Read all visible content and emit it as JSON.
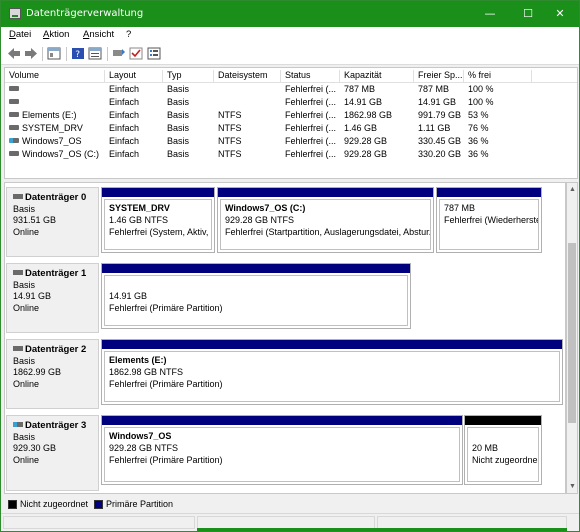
{
  "window": {
    "title": "Datenträgerverwaltung",
    "minimize": "—",
    "maximize": "☐",
    "close": "✕"
  },
  "menu": [
    "Datei",
    "Aktion",
    "Ansicht",
    "?"
  ],
  "toolbar": [
    "back-icon",
    "forward-icon",
    "console-tree-icon",
    "help-icon",
    "properties-icon",
    "rescan-icon",
    "check-icon",
    "list-icon"
  ],
  "volumes": {
    "headers": [
      "Volume",
      "Layout",
      "Typ",
      "Dateisystem",
      "Status",
      "Kapazität",
      "Freier Sp...",
      "% frei"
    ],
    "rows": [
      {
        "volume": "",
        "layout": "Einfach",
        "typ": "Basis",
        "fs": "",
        "status": "Fehlerfrei (...",
        "cap": "787 MB",
        "free": "787 MB",
        "pct": "100 %",
        "icon": "drive"
      },
      {
        "volume": "",
        "layout": "Einfach",
        "typ": "Basis",
        "fs": "",
        "status": "Fehlerfrei (...",
        "cap": "14.91 GB",
        "free": "14.91 GB",
        "pct": "100 %",
        "icon": "drive"
      },
      {
        "volume": "Elements (E:)",
        "layout": "Einfach",
        "typ": "Basis",
        "fs": "NTFS",
        "status": "Fehlerfrei (...",
        "cap": "1862.98 GB",
        "free": "991.79 GB",
        "pct": "53 %",
        "icon": "drive"
      },
      {
        "volume": "SYSTEM_DRV",
        "layout": "Einfach",
        "typ": "Basis",
        "fs": "NTFS",
        "status": "Fehlerfrei (...",
        "cap": "1.46 GB",
        "free": "1.11 GB",
        "pct": "76 %",
        "icon": "drive"
      },
      {
        "volume": "Windows7_OS",
        "layout": "Einfach",
        "typ": "Basis",
        "fs": "NTFS",
        "status": "Fehlerfrei (...",
        "cap": "929.28 GB",
        "free": "330.45 GB",
        "pct": "36 %",
        "icon": "os-drive"
      },
      {
        "volume": "Windows7_OS (C:)",
        "layout": "Einfach",
        "typ": "Basis",
        "fs": "NTFS",
        "status": "Fehlerfrei (...",
        "cap": "929.28 GB",
        "free": "330.20 GB",
        "pct": "36 %",
        "icon": "drive"
      }
    ]
  },
  "disks": [
    {
      "name": "Datenträger 0",
      "type": "Basis",
      "size": "931.51 GB",
      "state": "Online",
      "icon": "drive",
      "partitions": [
        {
          "name": "SYSTEM_DRV",
          "size": "1.46 GB NTFS",
          "status": "Fehlerfrei (System, Aktiv, I",
          "bar": "primary"
        },
        {
          "name": "Windows7_OS  (C:)",
          "size": "929.28 GB NTFS",
          "status": "Fehlerfrei (Startpartition, Auslagerungsdatei, Absturz",
          "bar": "primary"
        },
        {
          "name": "",
          "size": "787 MB",
          "status": "Fehlerfrei (Wiederherste",
          "bar": "primary"
        }
      ]
    },
    {
      "name": "Datenträger 1",
      "type": "Basis",
      "size": "14.91 GB",
      "state": "Online",
      "icon": "drive",
      "partitions": [
        {
          "name": "",
          "size": "14.91 GB",
          "status": "Fehlerfrei (Primäre Partition)",
          "bar": "primary"
        }
      ]
    },
    {
      "name": "Datenträger 2",
      "type": "Basis",
      "size": "1862.99 GB",
      "state": "Online",
      "icon": "drive",
      "partitions": [
        {
          "name": "Elements  (E:)",
          "size": "1862.98 GB NTFS",
          "status": "Fehlerfrei (Primäre Partition)",
          "bar": "primary"
        }
      ]
    },
    {
      "name": "Datenträger 3",
      "type": "Basis",
      "size": "929.30 GB",
      "state": "Online",
      "icon": "os-drive",
      "partitions": [
        {
          "name": "Windows7_OS",
          "size": "929.28 GB NTFS",
          "status": "Fehlerfrei (Primäre Partition)",
          "bar": "primary"
        },
        {
          "name": "",
          "size": "20 MB",
          "status": "Nicht zugeordne",
          "bar": "unallocated"
        }
      ]
    }
  ],
  "legend": {
    "unallocated": "Nicht zugeordnet",
    "primary": "Primäre Partition"
  },
  "colors": {
    "primary": "#00007f",
    "unallocated": "#000000",
    "titlebar": "#1a8f1a"
  }
}
